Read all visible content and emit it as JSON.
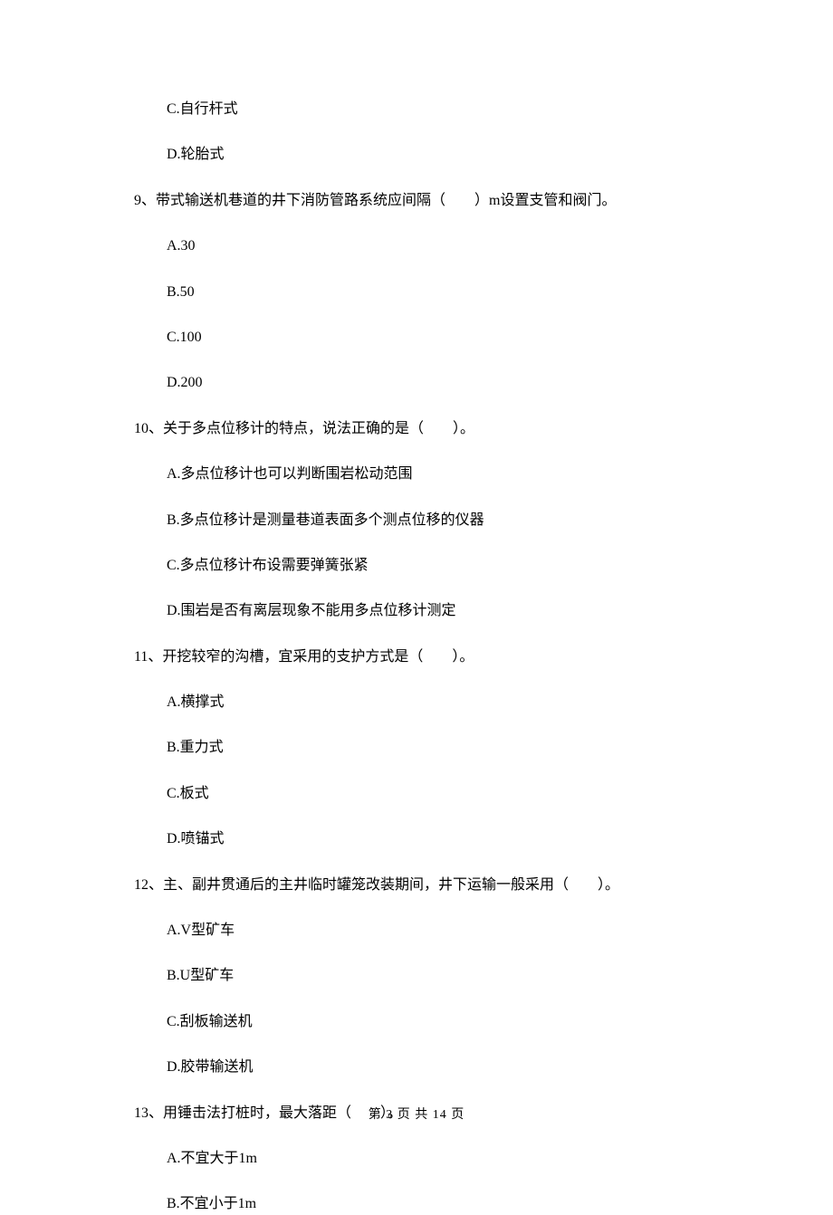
{
  "q8": {
    "options": {
      "c": "C.自行杆式",
      "d": "D.轮胎式"
    }
  },
  "q9": {
    "text": "9、带式输送机巷道的井下消防管路系统应间隔（　　）m设置支管和阀门。",
    "options": {
      "a": "A.30",
      "b": "B.50",
      "c": "C.100",
      "d": "D.200"
    }
  },
  "q10": {
    "text": "10、关于多点位移计的特点，说法正确的是（　　）。",
    "options": {
      "a": "A.多点位移计也可以判断围岩松动范围",
      "b": "B.多点位移计是测量巷道表面多个测点位移的仪器",
      "c": "C.多点位移计布设需要弹簧张紧",
      "d": "D.围岩是否有离层现象不能用多点位移计测定"
    }
  },
  "q11": {
    "text": "11、开挖较窄的沟槽，宜采用的支护方式是（　　）。",
    "options": {
      "a": "A.横撑式",
      "b": "B.重力式",
      "c": "C.板式",
      "d": "D.喷锚式"
    }
  },
  "q12": {
    "text": "12、主、副井贯通后的主井临时罐笼改装期间，井下运输一般采用（　　）。",
    "options": {
      "a": "A.V型矿车",
      "b": "B.U型矿车",
      "c": "C.刮板输送机",
      "d": "D.胶带输送机"
    }
  },
  "q13": {
    "text": "13、用锤击法打桩时，最大落距（　　）。",
    "options": {
      "a": "A.不宜大于1m",
      "b": "B.不宜小于1m"
    }
  },
  "footer": "第 3 页 共 14 页"
}
